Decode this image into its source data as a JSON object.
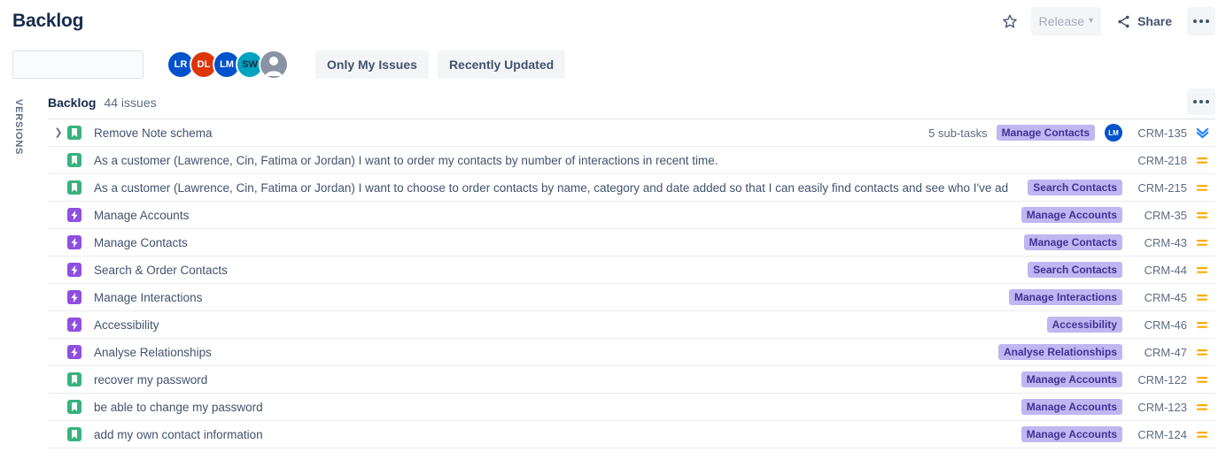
{
  "header": {
    "title": "Backlog",
    "star_icon": "star-icon",
    "release": {
      "label": "Release",
      "chevron": "⌄"
    },
    "share": {
      "label": "Share",
      "icon": "share-icon"
    },
    "more": {
      "label": "More actions",
      "icon": "more-dots-icon"
    }
  },
  "toolbar": {
    "search": {
      "value": "",
      "placeholder": "",
      "icon": "search-icon"
    },
    "avatars": [
      {
        "initials": "LR",
        "color": "#0052cc"
      },
      {
        "initials": "DL",
        "color": "#de350b"
      },
      {
        "initials": "LM",
        "color": "#0052cc"
      },
      {
        "initials": "SW",
        "color": "#00a3bf",
        "text_color": "#172b4d"
      }
    ],
    "generic_avatar_icon": "person-avatar-icon",
    "filters": [
      {
        "label": "Only My Issues"
      },
      {
        "label": "Recently Updated"
      }
    ]
  },
  "sidebar": {
    "versions_label": "VERSIONS"
  },
  "backlog": {
    "name": "Backlog",
    "count_label": "44 issues",
    "menu_icon": "more-dots-icon",
    "issues": [
      {
        "expandable": true,
        "type": "story",
        "summary": "Remove Note schema",
        "subtasks": "5 sub-tasks",
        "epic": "Manage Contacts",
        "assignee": {
          "initials": "LM",
          "color": "#0052cc"
        },
        "key": "CRM-135",
        "priority": "low"
      },
      {
        "expandable": false,
        "type": "story",
        "summary": "As a customer (Lawrence, Cin, Fatima or Jordan) I want to order my contacts by number of interactions in recent time.",
        "subtasks": "",
        "epic": "",
        "assignee": null,
        "key": "CRM-218",
        "priority": "medium"
      },
      {
        "expandable": false,
        "type": "story",
        "summary": "As a customer (Lawrence, Cin, Fatima or Jordan) I want to choose to order contacts by name, category and date added so that I can easily find contacts and see who I've ad",
        "subtasks": "",
        "epic": "Search Contacts",
        "assignee": null,
        "key": "CRM-215",
        "priority": "medium"
      },
      {
        "expandable": false,
        "type": "epic",
        "summary": "Manage Accounts",
        "subtasks": "",
        "epic": "Manage Accounts",
        "assignee": null,
        "key": "CRM-35",
        "priority": "medium"
      },
      {
        "expandable": false,
        "type": "epic",
        "summary": "Manage Contacts",
        "subtasks": "",
        "epic": "Manage Contacts",
        "assignee": null,
        "key": "CRM-43",
        "priority": "medium"
      },
      {
        "expandable": false,
        "type": "epic",
        "summary": "Search & Order Contacts",
        "subtasks": "",
        "epic": "Search Contacts",
        "assignee": null,
        "key": "CRM-44",
        "priority": "medium"
      },
      {
        "expandable": false,
        "type": "epic",
        "summary": "Manage Interactions",
        "subtasks": "",
        "epic": "Manage Interactions",
        "assignee": null,
        "key": "CRM-45",
        "priority": "medium"
      },
      {
        "expandable": false,
        "type": "epic",
        "summary": "Accessibility",
        "subtasks": "",
        "epic": "Accessibility",
        "assignee": null,
        "key": "CRM-46",
        "priority": "medium"
      },
      {
        "expandable": false,
        "type": "epic",
        "summary": "Analyse Relationships",
        "subtasks": "",
        "epic": "Analyse Relationships",
        "assignee": null,
        "key": "CRM-47",
        "priority": "medium"
      },
      {
        "expandable": false,
        "type": "story",
        "summary": "recover my password",
        "subtasks": "",
        "epic": "Manage Accounts",
        "assignee": null,
        "key": "CRM-122",
        "priority": "medium"
      },
      {
        "expandable": false,
        "type": "story",
        "summary": "be able to change my password",
        "subtasks": "",
        "epic": "Manage Accounts",
        "assignee": null,
        "key": "CRM-123",
        "priority": "medium"
      },
      {
        "expandable": false,
        "type": "story",
        "summary": "add my own contact information",
        "subtasks": "",
        "epic": "Manage Accounts",
        "assignee": null,
        "key": "CRM-124",
        "priority": "medium"
      }
    ]
  },
  "colors": {
    "epic_badge_bg": "#c0b6f2",
    "epic_badge_text": "#403294",
    "story_icon": "#36b37e",
    "epic_icon": "#904ee2",
    "priority_medium": "#ffab00",
    "priority_low": "#2684ff"
  }
}
